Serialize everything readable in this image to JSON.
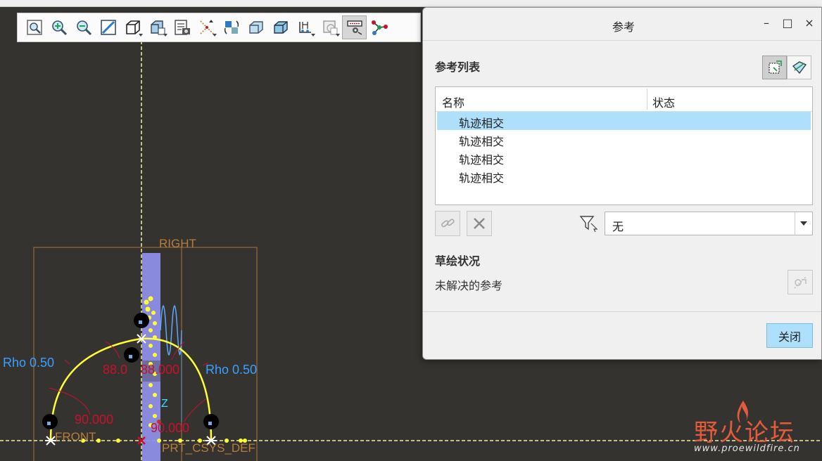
{
  "toolbar": {
    "buttons": [
      {
        "name": "refit",
        "icon": "refit-icon"
      },
      {
        "name": "zoom-in",
        "icon": "zoom-in-icon"
      },
      {
        "name": "zoom-out",
        "icon": "zoom-out-icon"
      },
      {
        "name": "repaint",
        "icon": "repaint-icon"
      },
      {
        "name": "display-style",
        "icon": "display-style-icon"
      },
      {
        "name": "saved-orientations",
        "icon": "saved-orientations-icon"
      },
      {
        "name": "view-manager",
        "icon": "view-manager-icon"
      },
      {
        "name": "datum-display",
        "icon": "datum-display-icon"
      },
      {
        "name": "spin-center",
        "icon": "spin-center-icon"
      },
      {
        "name": "annotation-display",
        "icon": "annotation-display-icon"
      },
      {
        "name": "appearance",
        "icon": "appearance-icon"
      },
      {
        "name": "sketcher-display",
        "icon": "sketcher-display-icon"
      },
      {
        "name": "sketch-view",
        "icon": "sketch-view-icon"
      },
      {
        "name": "references",
        "icon": "references-icon"
      },
      {
        "name": "sketch-tools",
        "icon": "sketch-tools-icon"
      }
    ]
  },
  "dialog": {
    "title": "参考",
    "minimize": "–",
    "maximize": "□",
    "close": "×",
    "list_label": "参考列表",
    "columns": [
      "名称",
      "状态"
    ],
    "rows": [
      "轨迹相交",
      "轨迹相交",
      "轨迹相交",
      "轨迹相交"
    ],
    "selected_row": 0,
    "filter_value": "无",
    "status_label": "草绘状况",
    "status_text": "未解决的参考",
    "close_button": "关闭"
  },
  "canvas": {
    "labels": {
      "right": "RIGHT",
      "front": "FRONT",
      "csys": "PRT_CSYS_DEF",
      "z_axis": "Z",
      "rho_left": "Rho 0.50",
      "rho_right": "Rho 0.50",
      "dim_left_top": "88.0",
      "dim_right_top": "88.000",
      "dim_left_bottom": "90.000",
      "dim_right_bottom": "90.000"
    },
    "colors": {
      "background": "#35332f",
      "sketch": "#ffff33",
      "dimension": "#c8102e",
      "rho": "#3aa0ff",
      "datum": "#b87d3a",
      "highlight": "#8e8ee8"
    }
  },
  "watermark": {
    "title": "野火论坛",
    "url": "www.proewildfire.cn"
  }
}
